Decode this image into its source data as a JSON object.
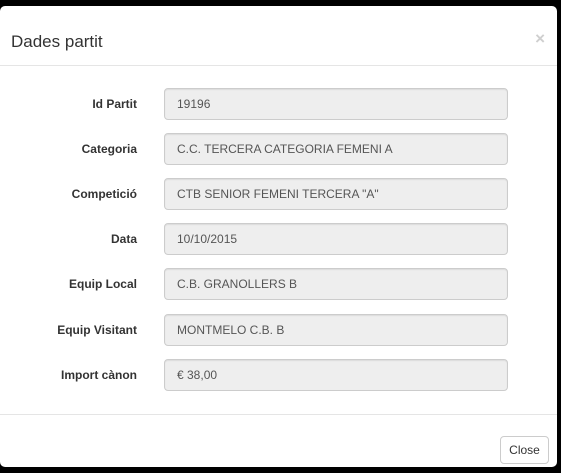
{
  "modal": {
    "title": "Dades partit",
    "close_glyph": "×",
    "close_icon": "close-icon"
  },
  "fields": [
    {
      "label": "Id Partit",
      "value": "19196"
    },
    {
      "label": "Categoria",
      "value": "C.C. TERCERA CATEGORIA FEMENI  A"
    },
    {
      "label": "Competició",
      "value": "CTB SENIOR FEMENI TERCERA \"A\""
    },
    {
      "label": "Data",
      "value": "10/10/2015"
    },
    {
      "label": "Equip Local",
      "value": "C.B. GRANOLLERS B"
    },
    {
      "label": "Equip Visitant",
      "value": "MONTMELO C.B. B"
    },
    {
      "label": "Import cànon",
      "value": "€ 38,00"
    }
  ],
  "footer": {
    "close_label": "Close"
  },
  "colors": {
    "input_background": "#eeeeee",
    "input_border": "#cccccc",
    "label_text": "#333333",
    "overlay": "#000000"
  }
}
